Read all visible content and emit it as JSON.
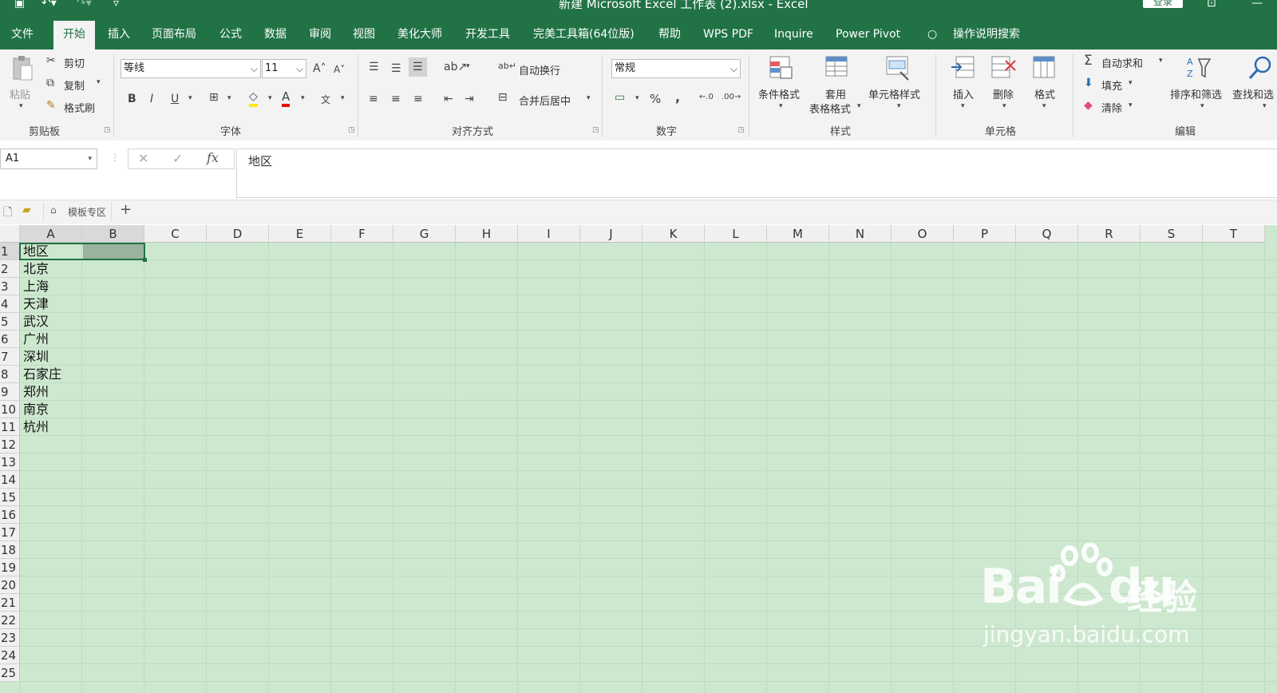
{
  "app": {
    "window_title": "新建 Microsoft Excel 工作表 (2).xlsx  -  Excel",
    "login_label": "登录"
  },
  "tabs": [
    "文件",
    "开始",
    "插入",
    "页面布局",
    "公式",
    "数据",
    "审阅",
    "视图",
    "美化大师",
    "开发工具",
    "完美工具箱(64位版)",
    "帮助",
    "WPS PDF",
    "Inquire",
    "Power Pivot",
    "操作说明搜索"
  ],
  "active_tab": "开始",
  "ribbon": {
    "clipboard": {
      "paste": "粘贴",
      "cut": "剪切",
      "copy": "复制",
      "format_painter": "格式刷",
      "group": "剪贴板"
    },
    "font": {
      "name": "等线",
      "size": "11",
      "grow": "A",
      "shrink": "A",
      "bold": "B",
      "italic": "I",
      "underline": "U",
      "font_color": "A",
      "phonetic": "文",
      "group": "字体"
    },
    "alignment": {
      "wrap": "自动换行",
      "merge": "合并后居中",
      "group": "对齐方式"
    },
    "number": {
      "format": "常规",
      "percent": "%",
      "comma": ",",
      "group": "数字"
    },
    "styles": {
      "conditional": "条件格式",
      "table_line1": "套用",
      "table_line2": "表格格式",
      "cell_styles": "单元格样式",
      "group": "样式"
    },
    "cells": {
      "insert": "插入",
      "delete": "删除",
      "format": "格式",
      "group": "单元格"
    },
    "editing": {
      "autosum": "自动求和",
      "fill": "填充",
      "clear": "清除",
      "sort": "排序和筛选",
      "find": "查找和选",
      "group": "编辑"
    }
  },
  "formula_bar": {
    "name_box": "A1",
    "fx": "fx",
    "content": "地区"
  },
  "template_strip": {
    "label": "模板专区",
    "add": "+"
  },
  "columns": [
    "A",
    "B",
    "C",
    "D",
    "E",
    "F",
    "G",
    "H",
    "I",
    "J",
    "K",
    "L",
    "M",
    "N",
    "O",
    "P",
    "Q",
    "R",
    "S",
    "T"
  ],
  "rows": [
    "1",
    "2",
    "3",
    "4",
    "5",
    "6",
    "7",
    "8",
    "9",
    "10",
    "11",
    "12",
    "13",
    "14",
    "15",
    "16",
    "17",
    "18",
    "19",
    "20",
    "21",
    "22",
    "23",
    "24",
    "25"
  ],
  "cells_A": [
    "地区",
    "北京",
    "上海",
    "天津",
    "武汉",
    "广州",
    "深圳",
    "石家庄",
    "郑州",
    "南京",
    "杭州"
  ],
  "watermark": {
    "brand": "Bai",
    "brand2": "du",
    "cn": "经验",
    "url": "jingyan.baidu.com"
  },
  "colors": {
    "excel_green": "#217346",
    "grid_bg": "#cde8cf"
  }
}
